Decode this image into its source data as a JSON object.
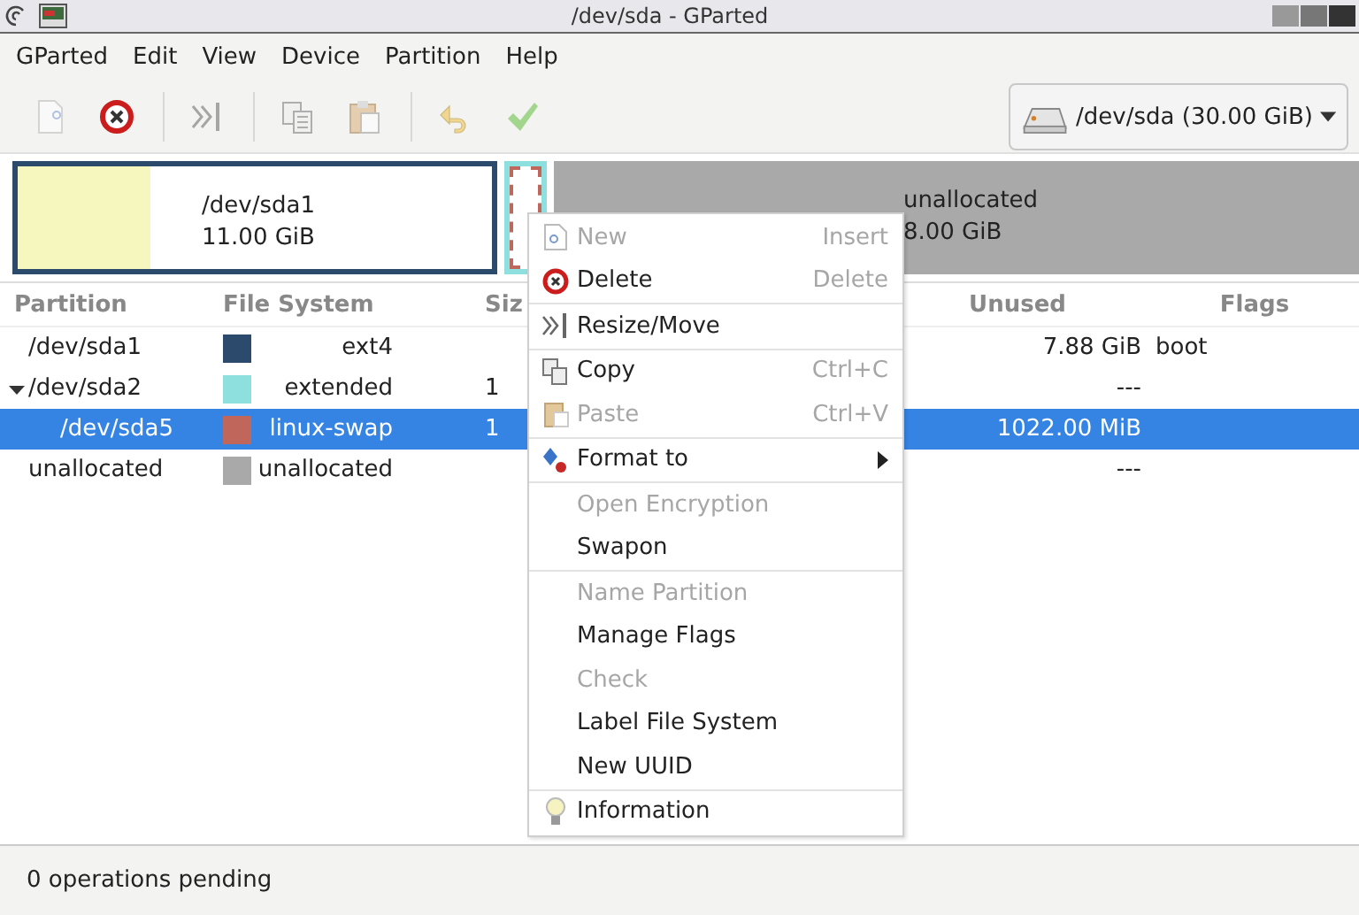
{
  "window": {
    "title": "/dev/sda - GParted"
  },
  "menubar": [
    "GParted",
    "Edit",
    "View",
    "Device",
    "Partition",
    "Help"
  ],
  "toolbar": [
    {
      "kind": "new",
      "disabled": true
    },
    {
      "kind": "delete",
      "disabled": false
    },
    {
      "kind": "resize",
      "disabled": true
    },
    {
      "kind": "copy",
      "disabled": true
    },
    {
      "kind": "paste",
      "disabled": true
    },
    {
      "kind": "undo",
      "disabled": true
    },
    {
      "kind": "apply",
      "disabled": true
    }
  ],
  "device_selector": {
    "value": "/dev/sda (30.00 GiB)"
  },
  "disk_map": [
    {
      "kind": "partition",
      "name": "/dev/sda1",
      "size": "11.00 GiB",
      "color": "#2c4a6b",
      "level": 0.28
    },
    {
      "kind": "extended",
      "color": "#8de0de"
    },
    {
      "kind": "unallocated",
      "name": "unallocated",
      "size": "8.00 GiB",
      "color": "#a9a9a9"
    }
  ],
  "table": {
    "columns": [
      "Partition",
      "File System",
      "Siz",
      "Unused",
      "Flags"
    ],
    "rows": [
      {
        "name": "/dev/sda1",
        "fs": "ext4",
        "color": "#2c4a6b",
        "unused": "7.88 GiB",
        "flags": "boot",
        "selected": false
      },
      {
        "name": "/dev/sda2",
        "fs": "extended",
        "color": "#8de0de",
        "size": "1",
        "unused": "---",
        "selected": false,
        "expanded": true,
        "children": [
          {
            "name": "/dev/sda5",
            "fs": "linux-swap",
            "color": "#c1665a",
            "size": "1",
            "unused": "1022.00 MiB",
            "selected": true
          }
        ]
      },
      {
        "name": "unallocated",
        "fs": "unallocated",
        "color": "#a9a9a9",
        "unused": "---",
        "selected": false
      }
    ]
  },
  "context_menu": [
    {
      "kind": "new",
      "label": "New",
      "shortcut": "Insert",
      "disabled": true,
      "separator_before": false
    },
    {
      "kind": "delete",
      "label": "Delete",
      "shortcut": "Delete",
      "disabled": false,
      "separator_before": false
    },
    {
      "kind": "resize",
      "label": "Resize/Move",
      "disabled": false,
      "separator_before": true
    },
    {
      "kind": "copy",
      "label": "Copy",
      "shortcut": "Ctrl+C",
      "disabled": false,
      "separator_before": true
    },
    {
      "kind": "paste",
      "label": "Paste",
      "shortcut": "Ctrl+V",
      "disabled": true,
      "separator_before": false
    },
    {
      "kind": "format",
      "label": "Format to",
      "submenu": true,
      "disabled": false,
      "separator_before": true
    },
    {
      "kind": "plain",
      "label": "Open Encryption",
      "disabled": true,
      "separator_before": true
    },
    {
      "kind": "plain",
      "label": "Swapon",
      "disabled": false,
      "separator_before": false
    },
    {
      "kind": "plain",
      "label": "Name Partition",
      "disabled": true,
      "separator_before": true
    },
    {
      "kind": "plain",
      "label": "Manage Flags",
      "disabled": false,
      "separator_before": false
    },
    {
      "kind": "plain",
      "label": "Check",
      "disabled": true,
      "separator_before": false
    },
    {
      "kind": "plain",
      "label": "Label File System",
      "disabled": false,
      "separator_before": false
    },
    {
      "kind": "plain",
      "label": "New UUID",
      "disabled": false,
      "separator_before": false
    },
    {
      "kind": "info",
      "label": "Information",
      "disabled": false,
      "separator_before": true
    }
  ],
  "status_bar": "0 operations pending"
}
